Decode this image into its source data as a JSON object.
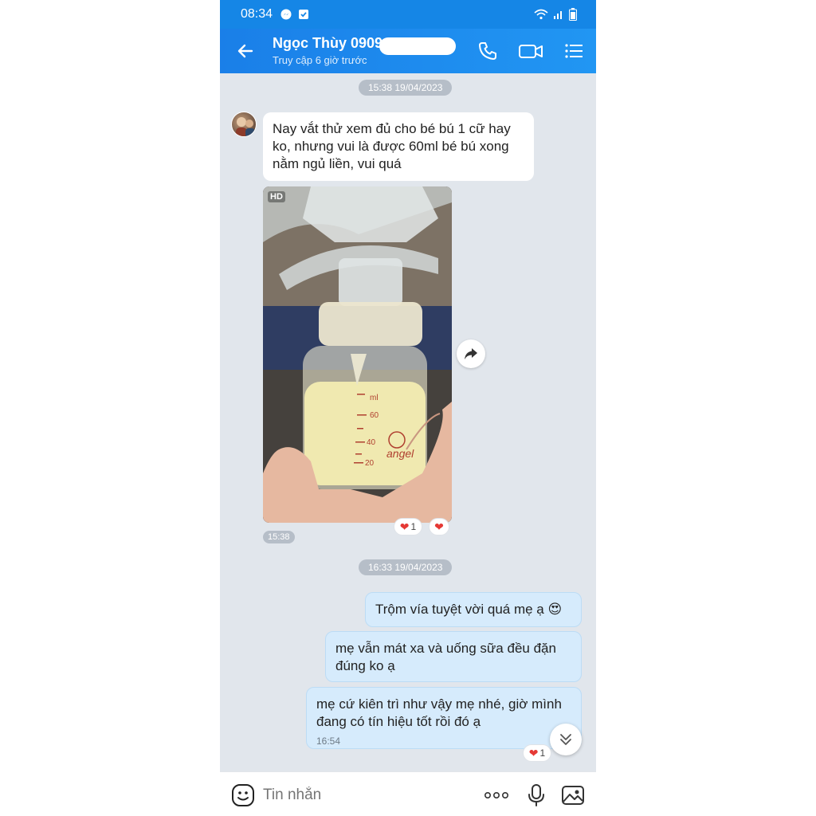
{
  "status_bar": {
    "time": "08:34"
  },
  "header": {
    "contact_name": "Ngọc Thùy 0909",
    "last_seen": "Truy cập 6 giờ trước"
  },
  "timestamps": {
    "first": "15:38 19/04/2023",
    "second": "16:33 19/04/2023"
  },
  "incoming": {
    "text": "Nay vắt thử xem đủ cho bé bú 1 cữ hay ko, nhưng vui là được 60ml bé bú xong nằm ngủ liền, vui quá",
    "photo_badge": "HD",
    "photo_time": "15:38",
    "reaction_count": "1"
  },
  "outgoing": [
    {
      "text": "Trộm vía tuyệt vời quá mẹ ạ 😍"
    },
    {
      "text": "mẹ vẫn mát xa và uống sữa đều đặn đúng ko ạ"
    },
    {
      "text": "mẹ cứ kiên trì như vậy mẹ nhé, giờ mình đang có tín hiệu tốt rồi đó ạ",
      "time": "16:54",
      "reaction_count": "1"
    }
  ],
  "input": {
    "placeholder": "Tin nhắn"
  },
  "icons": {
    "back": "back-arrow-icon",
    "call": "phone-icon",
    "video": "video-icon",
    "menu": "list-menu-icon",
    "emoji": "smiley-icon",
    "more": "more-dots-icon",
    "mic": "microphone-icon",
    "gallery": "image-icon",
    "share": "share-arrow-icon",
    "scroll": "chevron-double-down-icon"
  },
  "colors": {
    "accent": "#1a7fe8",
    "bubble_out": "#d6ebfc",
    "background": "#e1e6ec",
    "heart": "#e53935"
  }
}
